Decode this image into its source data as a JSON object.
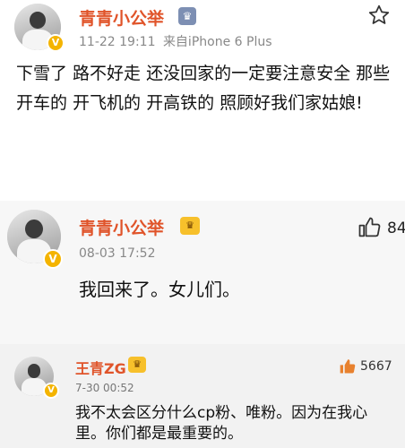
{
  "post1": {
    "username": "青青小公举",
    "timestamp": "11-22 19:11",
    "source": "来自iPhone 6 Plus",
    "text": "下雪了 路不好走 还没回家的一定要注意安全 那些开车的 开飞机的 开高铁的 照顾好我们家姑娘!",
    "favorite_icon": "star-icon",
    "verified_label": "V"
  },
  "post2": {
    "username": "青青小公举",
    "timestamp": "08-03 17:52",
    "text": "我回来了。女儿们。",
    "like_icon": "thumbs-up-icon",
    "like_count": "84",
    "verified_label": "V",
    "crown_label": "♛"
  },
  "comment": {
    "username": "王青ZG",
    "timestamp": "7-30 00:52",
    "text": "我不太会区分什么cp粉、唯粉。因为在我心里。你们都是最重要的。",
    "like_icon": "thumbs-up-icon",
    "like_count": "5667",
    "verified_label": "V",
    "crown_label": "♛",
    "like_color": "#e8812e"
  },
  "colors": {
    "username": "#e0542a",
    "meta": "#888888",
    "badge": "#f4b400"
  }
}
